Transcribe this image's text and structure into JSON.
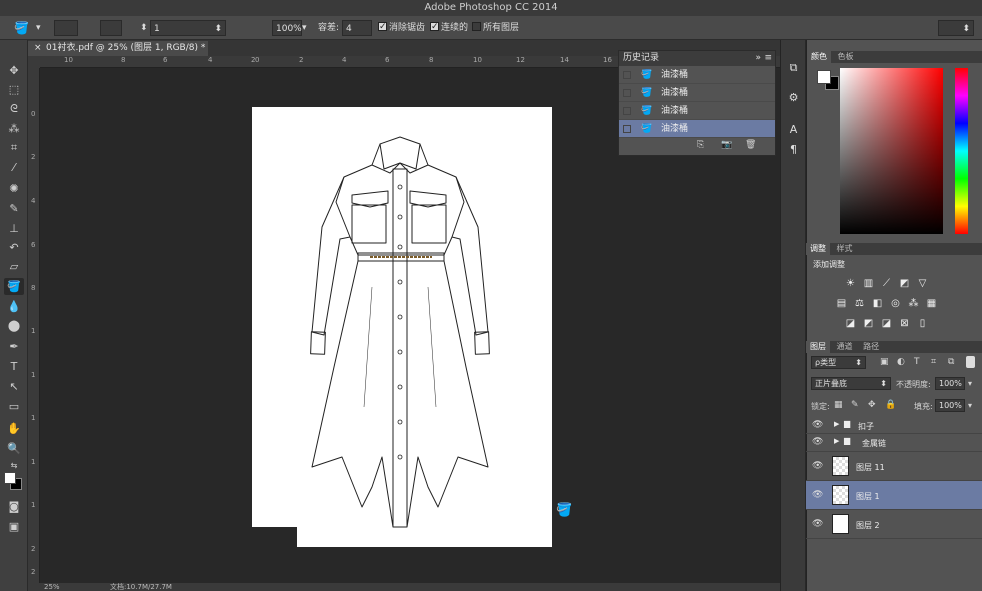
{
  "app": {
    "title": "Adobe Photoshop CC 2014"
  },
  "options": {
    "brush_size": "1",
    "opacity": "100%",
    "tolerance_label": "容差:",
    "tolerance": "4",
    "anti_alias": "消除锯齿",
    "contiguous": "连续的",
    "all_layers": "所有图层"
  },
  "document": {
    "tab_title": "01衬衣.pdf @ 25% (图层 1, RGB/8) *",
    "ruler_top": [
      "10",
      "8",
      "6",
      "4",
      "2",
      "0",
      "2",
      "4",
      "6",
      "8",
      "10",
      "12",
      "14",
      "16"
    ],
    "ruler_left": [
      "0",
      "2",
      "4",
      "6",
      "8",
      "1",
      "1",
      "1",
      "1",
      "1",
      "2",
      "2"
    ]
  },
  "history": {
    "title": "历史记录",
    "items": [
      {
        "label": "油漆桶",
        "selected": false
      },
      {
        "label": "油漆桶",
        "selected": false
      },
      {
        "label": "油漆桶",
        "selected": false
      },
      {
        "label": "油漆桶",
        "selected": true
      }
    ]
  },
  "color_panel": {
    "tabs": [
      "颜色",
      "色板"
    ],
    "foreground": "#ffffff",
    "background": "#000000"
  },
  "adjust_panel": {
    "tabs": [
      "调整",
      "样式"
    ],
    "heading": "添加调整"
  },
  "layers_panel": {
    "tabs": [
      "图层",
      "通道",
      "路径"
    ],
    "filter_label": "ρ类型",
    "blend_mode": "正片叠底",
    "opacity_label": "不透明度:",
    "opacity_value": "100%",
    "lock_label": "锁定:",
    "fill_label": "填充:",
    "fill_value": "100%",
    "layers": [
      {
        "name": "扣子",
        "type": "group",
        "selected": false
      },
      {
        "name": "金属链",
        "type": "group",
        "selected": false
      },
      {
        "name": "图层 11",
        "type": "layer",
        "selected": false
      },
      {
        "name": "图层 1",
        "type": "layer",
        "selected": true
      },
      {
        "name": "图层 2",
        "type": "layer",
        "selected": false
      }
    ]
  },
  "status": {
    "zoom": "25%",
    "doc_size": "文档:10.7M/27.7M"
  },
  "icons": {
    "toolbar": [
      "move-icon",
      "marquee-icon",
      "lasso-icon",
      "magic-wand-icon",
      "crop-icon",
      "eyedropper-icon",
      "healing-icon",
      "brush-icon",
      "stamp-icon",
      "history-brush-icon",
      "eraser-icon",
      "paint-bucket-icon",
      "blur-icon",
      "dodge-icon",
      "pen-icon",
      "type-icon",
      "path-select-icon",
      "rectangle-icon",
      "hand-icon",
      "zoom-icon"
    ]
  }
}
